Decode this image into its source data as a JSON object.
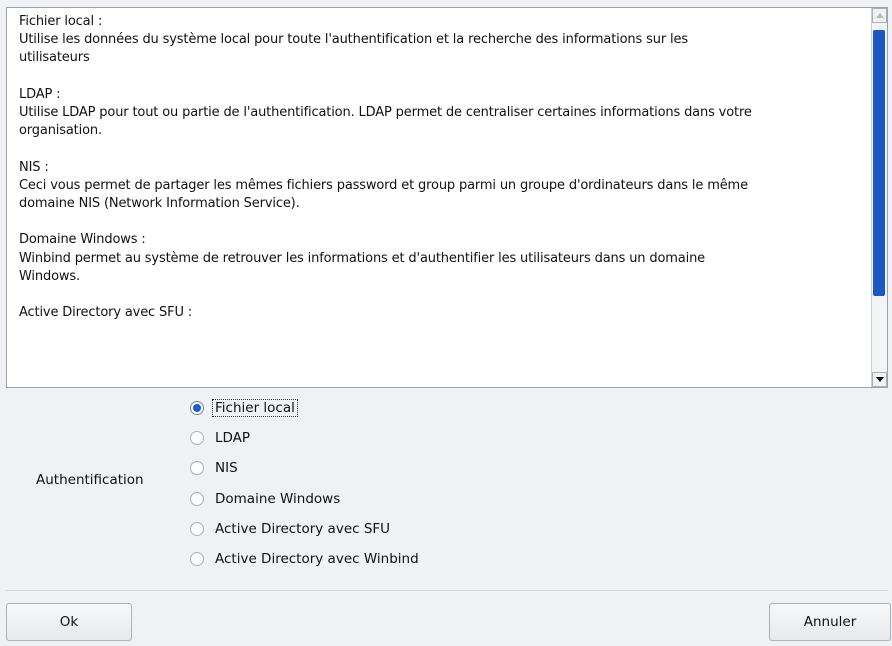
{
  "description": [
    {
      "title": "Fichier local :",
      "lines": [
        "Utilise les données du système local pour toute l'authentification et la recherche des informations sur les",
        "utilisateurs"
      ]
    },
    {
      "title": "LDAP :",
      "lines": [
        "Utilise LDAP pour tout ou partie de l'authentification. LDAP permet de centraliser certaines informations dans votre",
        "organisation."
      ]
    },
    {
      "title": "NIS :",
      "lines": [
        "Ceci vous permet de partager les mêmes fichiers password et group parmi un groupe d'ordinateurs dans le même",
        "domaine NIS (Network Information Service)."
      ]
    },
    {
      "title": "Domaine Windows :",
      "lines": [
        "Winbind permet au système de retrouver les informations et d'authentifier les utilisateurs dans un domaine",
        "Windows."
      ]
    },
    {
      "title": "Active Directory avec SFU :",
      "lines": []
    }
  ],
  "auth_label": "Authentification",
  "options": [
    {
      "label": "Fichier local",
      "selected": true
    },
    {
      "label": "LDAP",
      "selected": false
    },
    {
      "label": "NIS",
      "selected": false
    },
    {
      "label": "Domaine Windows",
      "selected": false
    },
    {
      "label": "Active Directory avec SFU",
      "selected": false
    },
    {
      "label": "Active Directory avec Winbind",
      "selected": false
    }
  ],
  "buttons": {
    "ok": "Ok",
    "cancel": "Annuler"
  },
  "colors": {
    "accent": "#1d5ad0",
    "scrollbar_thumb": "#1c57c4",
    "background": "#eff1f4"
  }
}
